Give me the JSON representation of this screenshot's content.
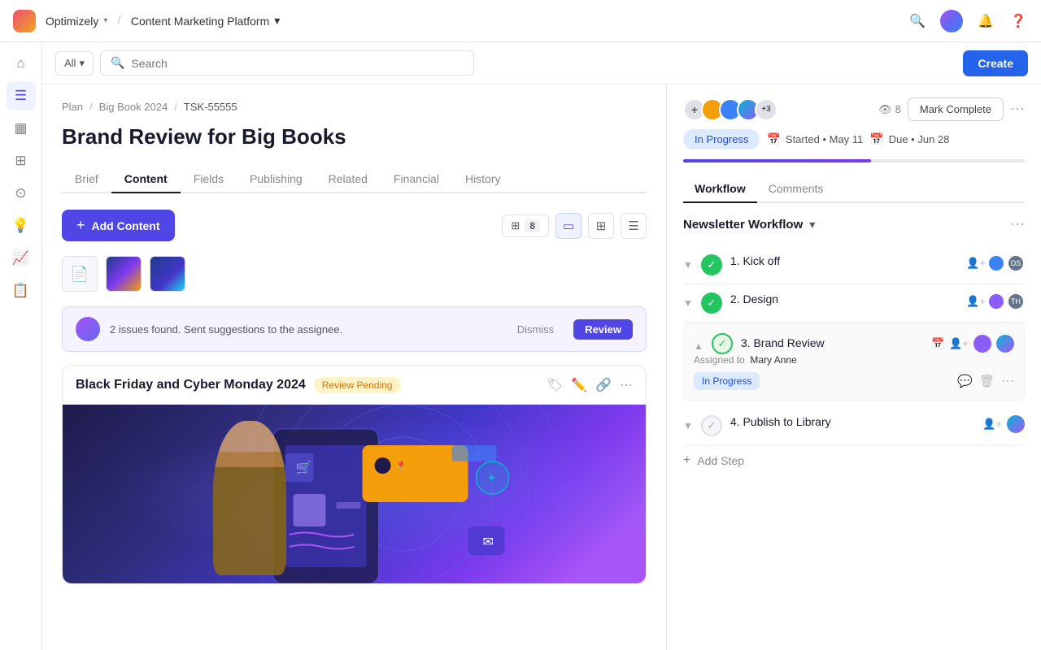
{
  "topbar": {
    "app_name": "Optimizely",
    "platform_name": "Content Marketing Platform",
    "chevron": "▾"
  },
  "searchbar": {
    "all_label": "All",
    "search_placeholder": "Search",
    "create_label": "Create"
  },
  "sidebar": {
    "items": [
      {
        "id": "home",
        "icon": "⌂"
      },
      {
        "id": "list",
        "icon": "☰"
      },
      {
        "id": "calendar",
        "icon": "▦"
      },
      {
        "id": "library",
        "icon": "⊞"
      },
      {
        "id": "tasks",
        "icon": "⊙"
      },
      {
        "id": "lightbulb",
        "icon": "💡"
      },
      {
        "id": "chart",
        "icon": "📈"
      },
      {
        "id": "report",
        "icon": "📋"
      }
    ],
    "active_index": 1
  },
  "breadcrumb": {
    "plan": "Plan",
    "big_book": "Big Book 2024",
    "task_id": "TSK-55555"
  },
  "page_title": "Brand Review for Big Books",
  "tabs": {
    "items": [
      "Brief",
      "Content",
      "Fields",
      "Publishing",
      "Related",
      "Financial",
      "History"
    ],
    "active": "Content"
  },
  "content": {
    "add_label": "Add Content",
    "count": "8",
    "thumbnails": [
      {
        "type": "doc",
        "icon": "📄"
      },
      {
        "type": "img",
        "label": "img1"
      },
      {
        "type": "img",
        "label": "img2"
      }
    ],
    "ai_alert": {
      "text": "2 issues found. Sent suggestions to the assignee.",
      "dismiss": "Dismiss",
      "review": "Review"
    },
    "card": {
      "title": "Black Friday and Cyber Monday 2024",
      "status": "Review Pending"
    }
  },
  "right_panel": {
    "status": "In Progress",
    "started_label": "Started • May 11",
    "due_label": "Due • Jun 28",
    "avatars_count": "+3",
    "eye_count": "8",
    "mark_complete": "Mark Complete",
    "progress": 55,
    "wf_tabs": {
      "items": [
        "Workflow",
        "Comments"
      ],
      "active": "Workflow"
    },
    "workflow": {
      "title": "Newsletter Workflow",
      "steps": [
        {
          "id": 1,
          "name": "1. Kick off",
          "status": "done",
          "assignees": [
            "DS"
          ]
        },
        {
          "id": 2,
          "name": "2. Design",
          "status": "done",
          "assignees": [
            "TH"
          ]
        },
        {
          "id": 3,
          "name": "3. Brand Review",
          "status": "expanded",
          "assignee_label": "Assigned to",
          "assignee_name": "Mary Anne",
          "step_status": "In Progress",
          "assignees": []
        },
        {
          "id": 4,
          "name": "4. Publish to Library",
          "status": "todo",
          "assignees": []
        }
      ],
      "add_step": "Add Step"
    }
  }
}
